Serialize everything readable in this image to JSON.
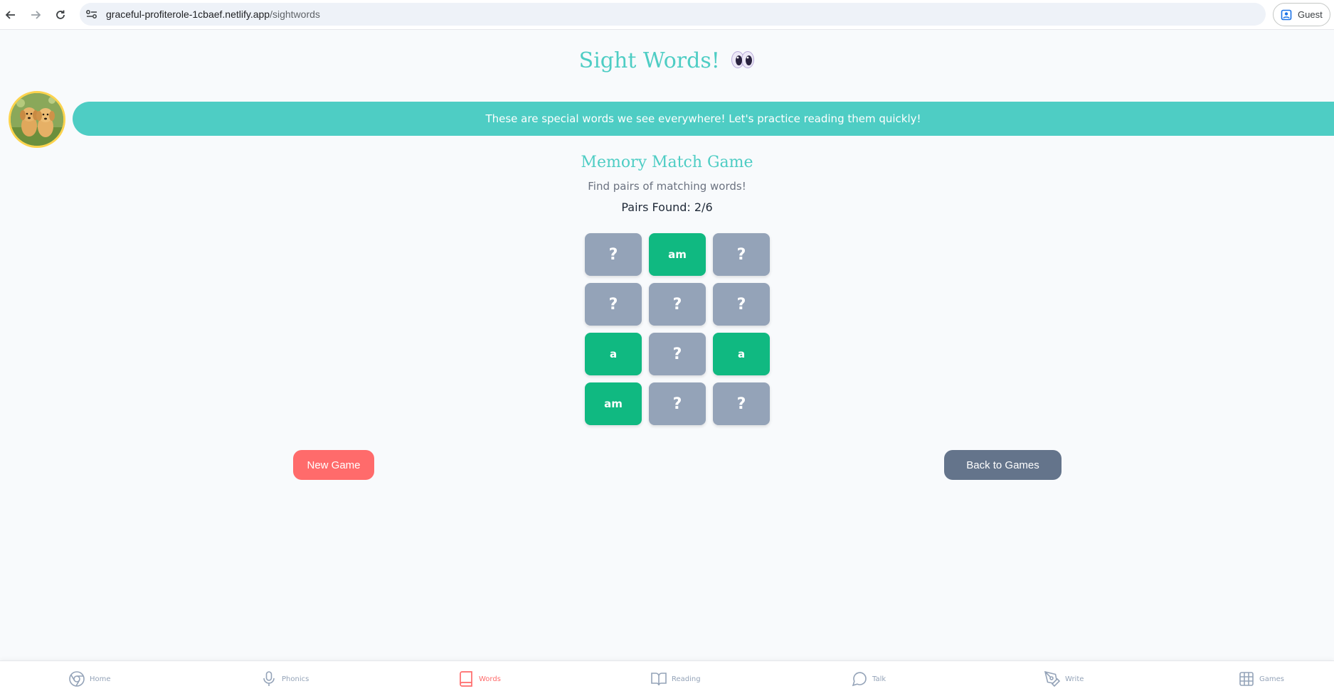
{
  "browser": {
    "url_host": "graceful-profiterole-1cbaef.netlify.app",
    "url_path": "/sightwords",
    "profile_label": "Guest"
  },
  "page": {
    "title": "Sight Words!",
    "banner_text": "These are special words we see everywhere! Let's practice reading them quickly!"
  },
  "game": {
    "title": "Memory Match Game",
    "subtitle": "Find pairs of matching words!",
    "pairs_found": "Pairs Found: 2/6",
    "cards": [
      {
        "label": "?",
        "state": "hidden"
      },
      {
        "label": "am",
        "state": "matched"
      },
      {
        "label": "?",
        "state": "hidden"
      },
      {
        "label": "?",
        "state": "hidden"
      },
      {
        "label": "?",
        "state": "hidden"
      },
      {
        "label": "?",
        "state": "hidden"
      },
      {
        "label": "a",
        "state": "matched"
      },
      {
        "label": "?",
        "state": "hidden"
      },
      {
        "label": "a",
        "state": "matched"
      },
      {
        "label": "am",
        "state": "matched"
      },
      {
        "label": "?",
        "state": "hidden"
      },
      {
        "label": "?",
        "state": "hidden"
      }
    ],
    "new_game_label": "New Game",
    "back_label": "Back to Games"
  },
  "nav": {
    "items": [
      {
        "label": "Home",
        "icon": "chrome-icon"
      },
      {
        "label": "Phonics",
        "icon": "microphone-icon"
      },
      {
        "label": "Words",
        "icon": "book-icon",
        "active": true
      },
      {
        "label": "Reading",
        "icon": "open-book-icon"
      },
      {
        "label": "Talk",
        "icon": "chat-bubble-icon"
      },
      {
        "label": "Write",
        "icon": "pen-icon"
      },
      {
        "label": "Games",
        "icon": "grid-icon"
      }
    ]
  },
  "colors": {
    "accent": "#4ecdc4",
    "matched": "#10b981",
    "hidden_card": "#94a3b8",
    "new_game": "#ff6b6b",
    "back": "#64748b",
    "active_nav": "#ff6b6b"
  }
}
